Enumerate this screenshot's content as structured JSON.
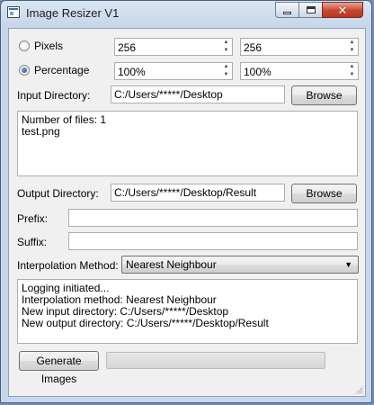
{
  "window": {
    "title": "Image Resizer V1"
  },
  "size_mode": {
    "pixels_label": "Pixels",
    "percentage_label": "Percentage",
    "selected": "Percentage",
    "pixel_width": "256",
    "pixel_height": "256",
    "percent_width": "100%",
    "percent_height": "100%"
  },
  "input": {
    "label": "Input Directory:",
    "value": "C:/Users/*****/Desktop",
    "browse_label": "Browse",
    "file_list": [
      "Number of files: 1",
      "test.png"
    ]
  },
  "output": {
    "label": "Output Directory:",
    "value": "C:/Users/*****/Desktop/Result",
    "browse_label": "Browse"
  },
  "prefix": {
    "label": "Prefix:",
    "value": ""
  },
  "suffix": {
    "label": "Suffix:",
    "value": ""
  },
  "interpolation": {
    "label": "Interpolation Method:",
    "selected": "Nearest Neighbour"
  },
  "log": {
    "lines": [
      "Logging initiated...",
      "Interpolation method: Nearest Neighbour",
      "New input directory: C:/Users/*****/Desktop",
      "New output directory: C:/Users/*****/Desktop/Result"
    ]
  },
  "actions": {
    "generate_label": "Generate Images",
    "progress": 0
  },
  "colors": {
    "progress_fill": "#06b025",
    "title_bar": "#c7d6ea",
    "close_button": "#c8452f"
  },
  "icons": {
    "app": "window-app-icon",
    "minimize": "minimize-icon",
    "maximize": "maximize-icon",
    "close": "close-icon",
    "spin_up": "spin-up-arrow-icon",
    "spin_down": "spin-down-arrow-icon",
    "dropdown": "chevron-down-icon"
  }
}
